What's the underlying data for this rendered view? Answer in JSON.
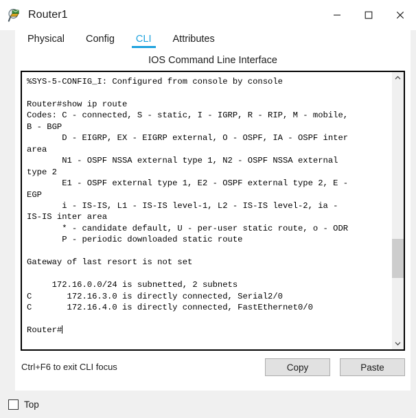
{
  "window": {
    "title": "Router1",
    "icon": "packet-tracer-device-icon",
    "controls": {
      "minimize": "—",
      "maximize": "□",
      "close": "✕"
    }
  },
  "tabs": [
    {
      "label": "Physical",
      "active": false
    },
    {
      "label": "Config",
      "active": false
    },
    {
      "label": "CLI",
      "active": true
    },
    {
      "label": "Attributes",
      "active": false
    }
  ],
  "section": {
    "title": "IOS Command Line Interface"
  },
  "terminal": {
    "text": "%SYS-5-CONFIG_I: Configured from console by console\n\nRouter#show ip route\nCodes: C - connected, S - static, I - IGRP, R - RIP, M - mobile,\nB - BGP\n       D - EIGRP, EX - EIGRP external, O - OSPF, IA - OSPF inter\narea\n       N1 - OSPF NSSA external type 1, N2 - OSPF NSSA external\ntype 2\n       E1 - OSPF external type 1, E2 - OSPF external type 2, E -\nEGP\n       i - IS-IS, L1 - IS-IS level-1, L2 - IS-IS level-2, ia -\nIS-IS inter area\n       * - candidate default, U - per-user static route, o - ODR\n       P - periodic downloaded static route\n\nGateway of last resort is not set\n\n     172.16.0.0/24 is subnetted, 2 subnets\nC       172.16.3.0 is directly connected, Serial2/0\nC       172.16.4.0 is directly connected, FastEthernet0/0\n\n",
    "prompt": "Router#",
    "lines": [
      "%SYS-5-CONFIG_I: Configured from console by console",
      "",
      "Router#show ip route",
      "Codes: C - connected, S - static, I - IGRP, R - RIP, M - mobile,",
      "B - BGP",
      "       D - EIGRP, EX - EIGRP external, O - OSPF, IA - OSPF inter",
      "area",
      "       N1 - OSPF NSSA external type 1, N2 - OSPF NSSA external",
      "type 2",
      "       E1 - OSPF external type 1, E2 - OSPF external type 2, E -",
      "EGP",
      "       i - IS-IS, L1 - IS-IS level-1, L2 - IS-IS level-2, ia -",
      "IS-IS inter area",
      "       * - candidate default, U - per-user static route, o - ODR",
      "       P - periodic downloaded static route",
      "",
      "Gateway of last resort is not set",
      "",
      "     172.16.0.0/24 is subnetted, 2 subnets",
      "C       172.16.3.0 is directly connected, Serial2/0",
      "C       172.16.4.0 is directly connected, FastEthernet0/0",
      "",
      "Router#"
    ],
    "routes": [
      {
        "code": "C",
        "network": "172.16.3.0",
        "state": "is directly connected",
        "interface": "Serial2/0"
      },
      {
        "code": "C",
        "network": "172.16.4.0",
        "state": "is directly connected",
        "interface": "FastEthernet0/0"
      }
    ]
  },
  "scrollbar": {
    "up_arrow": "∧",
    "down_arrow": "∨"
  },
  "footer": {
    "hint": "Ctrl+F6 to exit CLI focus",
    "copy_label": "Copy",
    "paste_label": "Paste"
  },
  "bottom": {
    "top_checkbox_label": "Top",
    "top_checked": false
  },
  "colors": {
    "accent": "#1ba1dd",
    "window_bg": "#ffffff",
    "frame_bg": "#f0f0f0",
    "button_bg": "#e1e1e1",
    "terminal_fg": "#000000",
    "scrollbar_thumb": "#cdcdcd"
  }
}
